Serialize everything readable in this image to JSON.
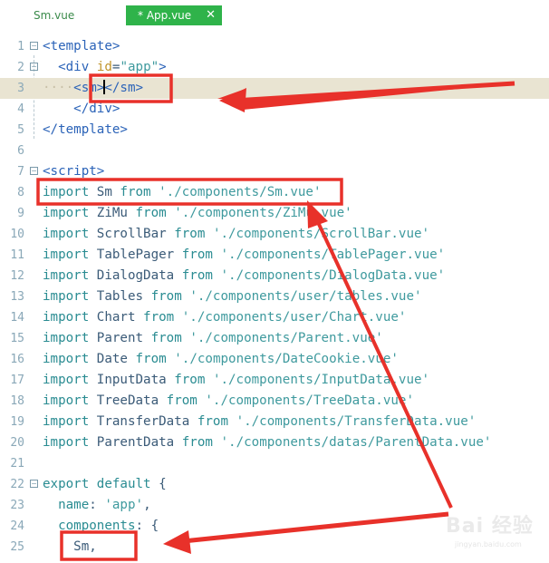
{
  "tabs": [
    {
      "label": "Sm.vue",
      "active": false
    },
    {
      "label": "* App.vue",
      "active": true,
      "close": "✕"
    }
  ],
  "lines": [
    {
      "n": "1",
      "fold": "minus",
      "tokens": [
        {
          "t": "<template>",
          "c": "tag"
        }
      ]
    },
    {
      "n": "2",
      "fold": "minus",
      "tokens": [
        {
          "t": "  ",
          "c": "plain"
        },
        {
          "t": "<div ",
          "c": "tag"
        },
        {
          "t": "id",
          "c": "attr"
        },
        {
          "t": "=",
          "c": "plain"
        },
        {
          "t": "\"app\"",
          "c": "str"
        },
        {
          "t": ">",
          "c": "tag"
        }
      ]
    },
    {
      "n": "3",
      "fold": "",
      "current": true,
      "tokens": [
        {
          "t": "····",
          "c": "dots"
        },
        {
          "t": "<sm>",
          "c": "tag"
        },
        {
          "t": "",
          "c": "caret"
        },
        {
          "t": "</sm>",
          "c": "tag"
        }
      ]
    },
    {
      "n": "4",
      "fold": "",
      "tokens": [
        {
          "t": "    ",
          "c": "plain"
        },
        {
          "t": "</div>",
          "c": "tag"
        }
      ]
    },
    {
      "n": "5",
      "fold": "",
      "tokens": [
        {
          "t": "</template>",
          "c": "tag"
        }
      ]
    },
    {
      "n": "6",
      "fold": "",
      "tokens": []
    },
    {
      "n": "7",
      "fold": "minus",
      "tokens": [
        {
          "t": "<script>",
          "c": "tag"
        }
      ]
    },
    {
      "n": "8",
      "fold": "",
      "tokens": [
        {
          "t": "import ",
          "c": "kw"
        },
        {
          "t": "Sm ",
          "c": "plain"
        },
        {
          "t": "from ",
          "c": "kw"
        },
        {
          "t": "'./components/Sm.vue'",
          "c": "str"
        }
      ]
    },
    {
      "n": "9",
      "fold": "",
      "tokens": [
        {
          "t": "import ",
          "c": "kw"
        },
        {
          "t": "ZiMu ",
          "c": "plain"
        },
        {
          "t": "from ",
          "c": "kw"
        },
        {
          "t": "'./components/ZiMu.vue'",
          "c": "str"
        }
      ]
    },
    {
      "n": "10",
      "fold": "",
      "tokens": [
        {
          "t": "import ",
          "c": "kw"
        },
        {
          "t": "ScrollBar ",
          "c": "plain"
        },
        {
          "t": "from ",
          "c": "kw"
        },
        {
          "t": "'./components/ScrollBar.vue'",
          "c": "str"
        }
      ]
    },
    {
      "n": "11",
      "fold": "",
      "tokens": [
        {
          "t": "import ",
          "c": "kw"
        },
        {
          "t": "TablePager ",
          "c": "plain"
        },
        {
          "t": "from ",
          "c": "kw"
        },
        {
          "t": "'./components/TablePager.vue'",
          "c": "str"
        }
      ]
    },
    {
      "n": "12",
      "fold": "",
      "tokens": [
        {
          "t": "import ",
          "c": "kw"
        },
        {
          "t": "DialogData ",
          "c": "plain"
        },
        {
          "t": "from ",
          "c": "kw"
        },
        {
          "t": "'./components/DialogData.vue'",
          "c": "str"
        }
      ]
    },
    {
      "n": "13",
      "fold": "",
      "tokens": [
        {
          "t": "import ",
          "c": "kw"
        },
        {
          "t": "Tables ",
          "c": "plain"
        },
        {
          "t": "from ",
          "c": "kw"
        },
        {
          "t": "'./components/user/tables.vue'",
          "c": "str"
        }
      ]
    },
    {
      "n": "14",
      "fold": "",
      "tokens": [
        {
          "t": "import ",
          "c": "kw"
        },
        {
          "t": "Chart ",
          "c": "plain"
        },
        {
          "t": "from ",
          "c": "kw"
        },
        {
          "t": "'./components/user/Chart.vue'",
          "c": "str"
        }
      ]
    },
    {
      "n": "15",
      "fold": "",
      "tokens": [
        {
          "t": "import ",
          "c": "kw"
        },
        {
          "t": "Parent ",
          "c": "plain"
        },
        {
          "t": "from ",
          "c": "kw"
        },
        {
          "t": "'./components/Parent.vue'",
          "c": "str"
        }
      ]
    },
    {
      "n": "16",
      "fold": "",
      "tokens": [
        {
          "t": "import ",
          "c": "kw"
        },
        {
          "t": "Date ",
          "c": "plain"
        },
        {
          "t": "from ",
          "c": "kw"
        },
        {
          "t": "'./components/DateCookie.vue'",
          "c": "str"
        }
      ]
    },
    {
      "n": "17",
      "fold": "",
      "tokens": [
        {
          "t": "import ",
          "c": "kw"
        },
        {
          "t": "InputData ",
          "c": "plain"
        },
        {
          "t": "from ",
          "c": "kw"
        },
        {
          "t": "'./components/InputData.vue'",
          "c": "str"
        }
      ]
    },
    {
      "n": "18",
      "fold": "",
      "tokens": [
        {
          "t": "import ",
          "c": "kw"
        },
        {
          "t": "TreeData ",
          "c": "plain"
        },
        {
          "t": "from ",
          "c": "kw"
        },
        {
          "t": "'./components/TreeData.vue'",
          "c": "str"
        }
      ]
    },
    {
      "n": "19",
      "fold": "",
      "tokens": [
        {
          "t": "import ",
          "c": "kw"
        },
        {
          "t": "TransferData ",
          "c": "plain"
        },
        {
          "t": "from ",
          "c": "kw"
        },
        {
          "t": "'./components/TransferData.vue'",
          "c": "str"
        }
      ]
    },
    {
      "n": "20",
      "fold": "",
      "tokens": [
        {
          "t": "import ",
          "c": "kw"
        },
        {
          "t": "ParentData ",
          "c": "plain"
        },
        {
          "t": "from ",
          "c": "kw"
        },
        {
          "t": "'./components/datas/ParentData.vue'",
          "c": "str"
        }
      ]
    },
    {
      "n": "21",
      "fold": "",
      "tokens": []
    },
    {
      "n": "22",
      "fold": "minus",
      "tokens": [
        {
          "t": "export ",
          "c": "kw"
        },
        {
          "t": "default ",
          "c": "kw"
        },
        {
          "t": "{",
          "c": "plain"
        }
      ]
    },
    {
      "n": "23",
      "fold": "",
      "tokens": [
        {
          "t": "  name",
          "c": "kw"
        },
        {
          "t": ": ",
          "c": "plain"
        },
        {
          "t": "'app'",
          "c": "str"
        },
        {
          "t": ",",
          "c": "plain"
        }
      ]
    },
    {
      "n": "24",
      "fold": "",
      "tokens": [
        {
          "t": "  components",
          "c": "kw"
        },
        {
          "t": ": {",
          "c": "plain"
        }
      ]
    },
    {
      "n": "25",
      "fold": "",
      "tokens": [
        {
          "t": "    Sm,",
          "c": "plain"
        }
      ]
    }
  ],
  "watermark": {
    "main": "Bai 经验",
    "sub": "jingyan.baidu.com"
  },
  "colors": {
    "annotation": "#e8312a",
    "active_tab": "#2fb34a",
    "current_line": "#e9e4d2"
  }
}
